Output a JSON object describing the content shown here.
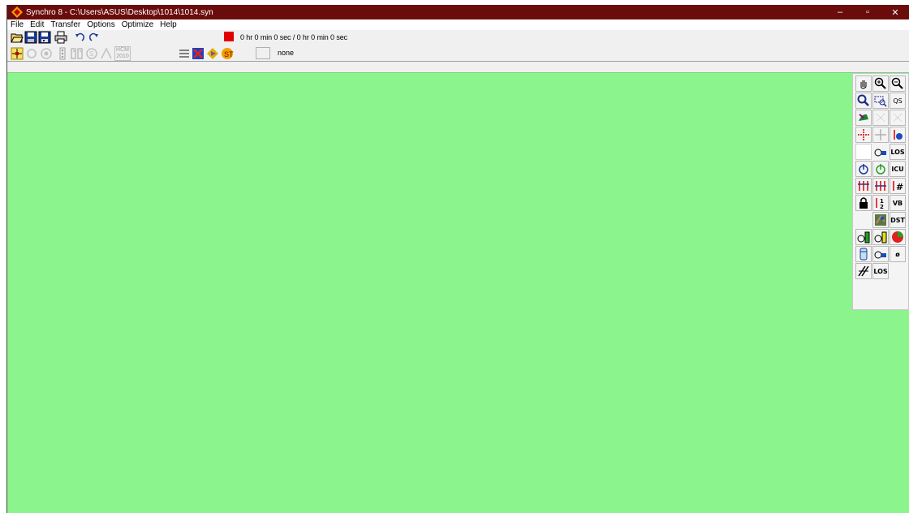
{
  "window": {
    "title": "Synchro 8 - C:\\Users\\ASUS\\Desktop\\1014\\1014.syn",
    "minimize_glyph": "–",
    "maximize_glyph": "▫",
    "close_glyph": "✕"
  },
  "menu": [
    "File",
    "Edit",
    "Transfer",
    "Options",
    "Optimize",
    "Help"
  ],
  "toolbar": {
    "clock_text": "0 hr 0 min 0 sec /  0 hr 0 min 0 sec",
    "status_text": "none",
    "hcm_label_top": "HCM",
    "hcm_label_bottom": "2010"
  },
  "palette": {
    "los_label": "LOS",
    "icu_label": "ICU",
    "vb_label": "VB",
    "dst_label": "DST",
    "phi_label": "ø",
    "los2_label": "LOS",
    "qs_label": "QS"
  },
  "colors": {
    "title_bar": "#6b0c0c",
    "map_canvas": "#8cf48c"
  }
}
